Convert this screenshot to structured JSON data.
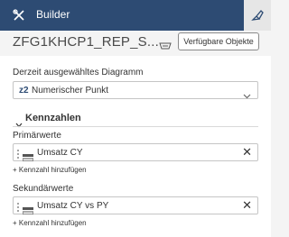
{
  "topbar": {
    "title": "Builder"
  },
  "header": {
    "model_name": "ZFG1KHCP1_REP_S...",
    "objects_button": "Verfügbare Objekte"
  },
  "chart_select": {
    "label": "Derzeit ausgewähltes Diagramm",
    "icon_text": "z2",
    "value": "Numerischer Punkt"
  },
  "section": {
    "title": "Kennzahlen"
  },
  "primary": {
    "label": "Primärwerte",
    "measure": "Umsatz CY",
    "add": "+ Kennzahl hinzufügen"
  },
  "secondary": {
    "label": "Sekundärwerte",
    "measure": "Umsatz CY vs PY",
    "add": "+ Kennzahl hinzufügen"
  },
  "colors": {
    "topbar": "#2d4b73",
    "accent": "#2d4b73",
    "panel": "#ffffff"
  }
}
